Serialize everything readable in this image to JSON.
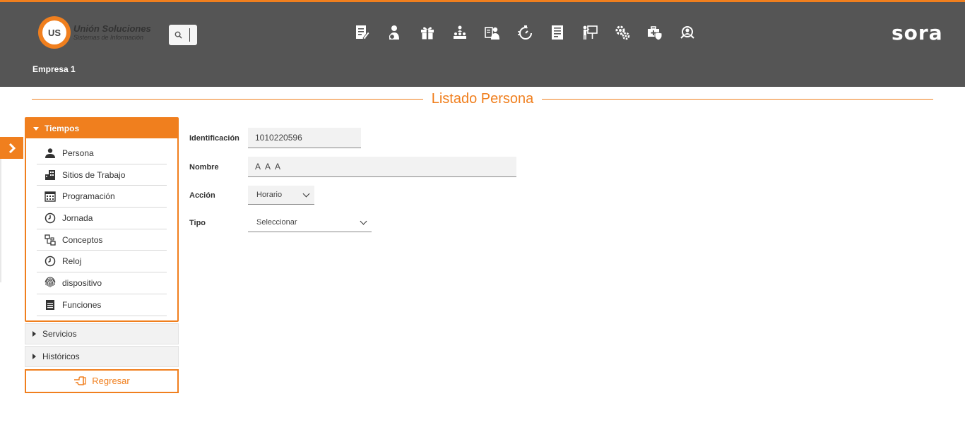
{
  "header": {
    "logo_badge": "US",
    "logo_title": "Unión Soluciones",
    "logo_subtitle": "Sistemas de Información",
    "brand": "sora",
    "company": "Empresa 1",
    "accent": "#f07f1e",
    "bg": "#555555",
    "nav_icons": [
      "document-edit-icon",
      "user-money-icon",
      "gift-icon",
      "org-chart-icon",
      "user-id-icon",
      "stopwatch-icon",
      "report-list-icon",
      "presentation-icon",
      "gears-icon",
      "medical-case-icon",
      "user-search-icon"
    ]
  },
  "page": {
    "title": "Listado Persona"
  },
  "sidebar": {
    "open_section": "Tiempos",
    "items": [
      {
        "label": "Persona",
        "icon": "person-icon"
      },
      {
        "label": "Sitios de Trabajo",
        "icon": "building-icon"
      },
      {
        "label": "Programación",
        "icon": "calendar-icon"
      },
      {
        "label": "Jornada",
        "icon": "clock-icon"
      },
      {
        "label": "Conceptos",
        "icon": "flow-icon"
      },
      {
        "label": "Reloj",
        "icon": "clock-icon"
      },
      {
        "label": "dispositivo",
        "icon": "fingerprint-icon"
      },
      {
        "label": "Funciones",
        "icon": "list-doc-icon"
      }
    ],
    "closed_sections": [
      "Servicios",
      "Históricos"
    ],
    "back_label": "Regresar"
  },
  "form": {
    "id_label": "Identificación",
    "id_value": "1010220596",
    "name_label": "Nombre",
    "name_value": "A A A",
    "action_label": "Acción",
    "action_value": "Horario",
    "type_label": "Tipo",
    "type_value": "Seleccionar"
  }
}
